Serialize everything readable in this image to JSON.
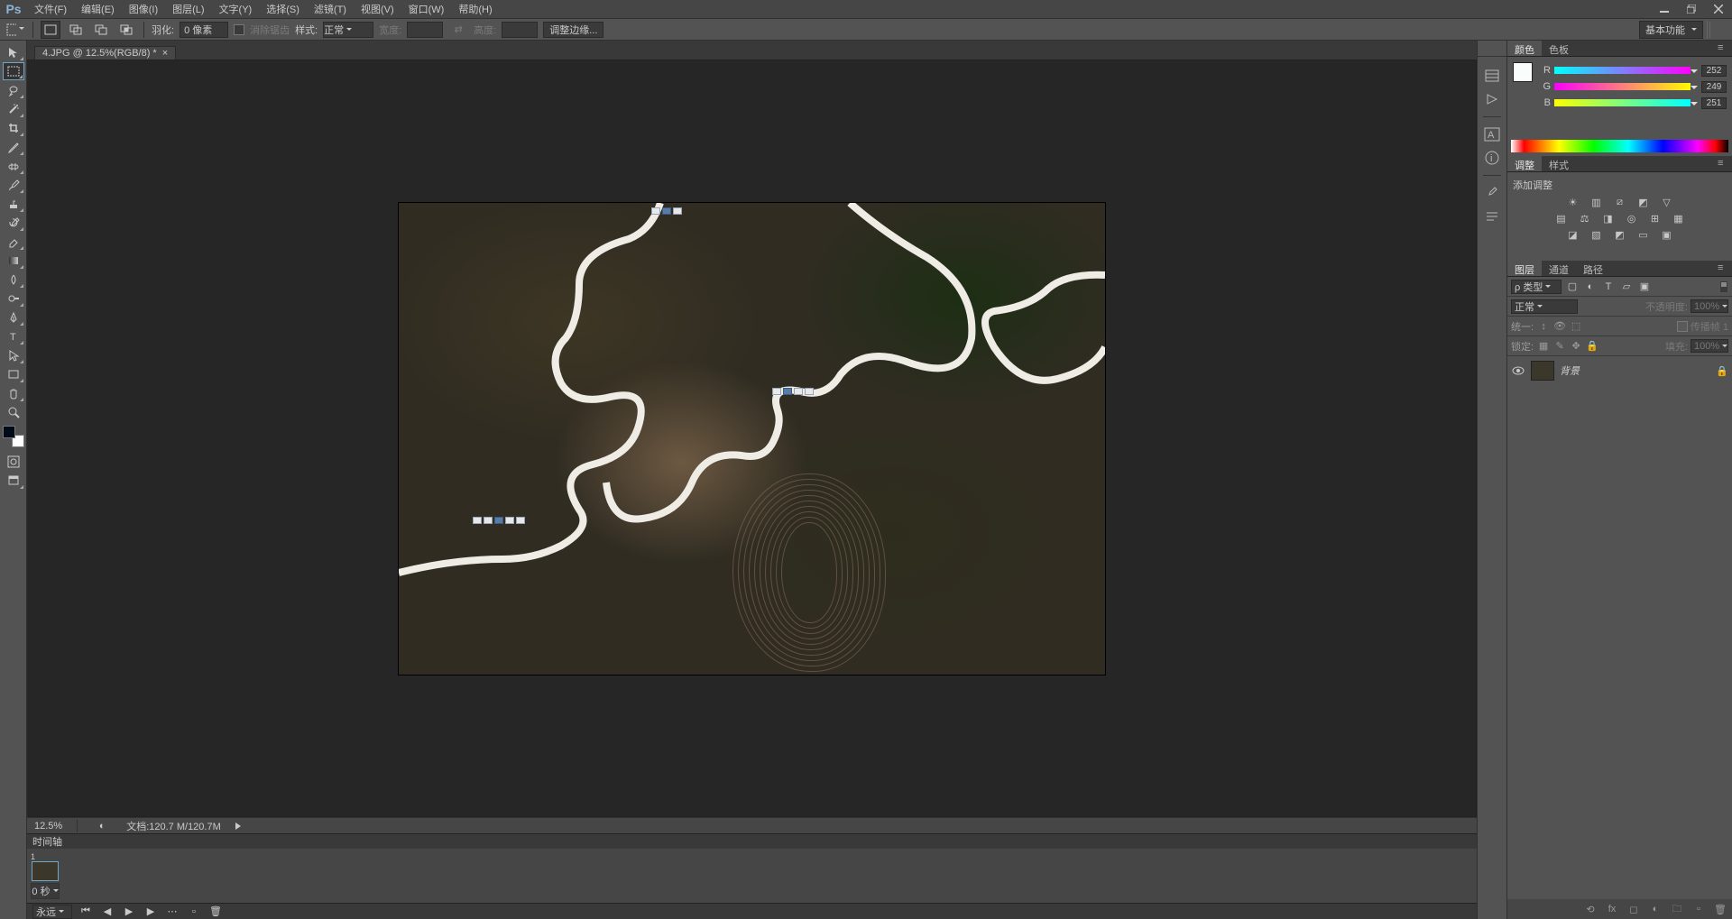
{
  "menu": {
    "file": "文件(F)",
    "edit": "编辑(E)",
    "image": "图像(I)",
    "layer": "图层(L)",
    "type": "文字(Y)",
    "select": "选择(S)",
    "filter": "滤镜(T)",
    "view": "视图(V)",
    "window": "窗口(W)",
    "help": "帮助(H)"
  },
  "options": {
    "feather_label": "羽化:",
    "feather_value": "0 像素",
    "antialias_label": "消除锯齿",
    "style_label": "样式:",
    "style_value": "正常",
    "width_label": "宽度:",
    "height_label": "高度:",
    "refine_edge": "调整边缘...",
    "workspace": "基本功能"
  },
  "tab": {
    "title": "4.JPG @ 12.5%(RGB/8) *"
  },
  "status": {
    "zoom": "12.5%",
    "doc_label": "文档:",
    "doc_size": "120.7 M/120.7M"
  },
  "timeline": {
    "title": "时间轴",
    "frame_no": "1",
    "frame_delay": "0 秒",
    "forever": "永远"
  },
  "panels": {
    "color_tab": "颜色",
    "swatch_tab": "色板",
    "r_label": "R",
    "g_label": "G",
    "b_label": "B",
    "r_val": "252",
    "g_val": "249",
    "b_val": "251",
    "adjust_tab": "调整",
    "styles_tab": "样式",
    "add_adjust": "添加调整",
    "layers_tab": "图层",
    "channels_tab": "通道",
    "paths_tab": "路径",
    "filter_type": "ρ 类型",
    "blend_mode": "正常",
    "opacity_label": "不透明度:",
    "opacity_value": "100%",
    "lock_label": "锁定:",
    "fill_label": "填充:",
    "fill_value": "100%",
    "propagate_label": "统一:",
    "propagate_frame": "传播帧 1",
    "layer_name": "背景"
  }
}
